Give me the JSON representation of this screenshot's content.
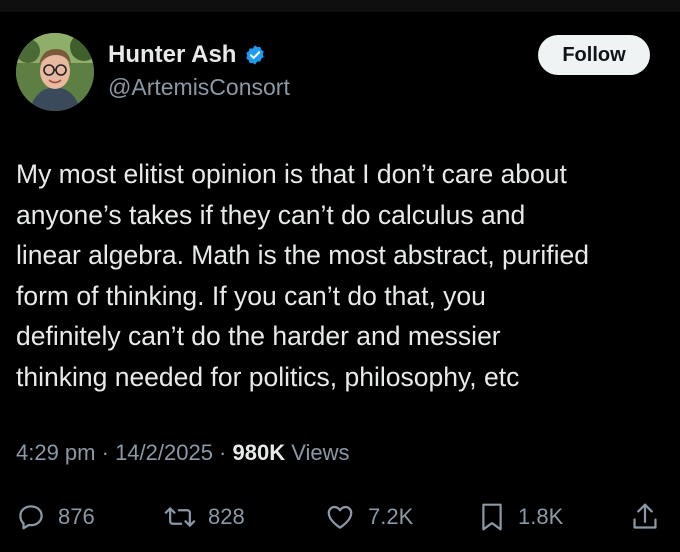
{
  "author": {
    "name": "Hunter Ash",
    "handle": "@ArtemisConsort",
    "verified_color": "#1d9bf0"
  },
  "follow_label": "Follow",
  "tweet": {
    "lines": [
      "My most elitist opinion is that I don’t care about",
      "anyone’s takes if they can’t do calculus and",
      "linear algebra. Math is the most abstract, purified",
      "form of thinking. If you can’t do that, you",
      "definitely can’t do the harder and messier",
      "thinking needed for politics, philosophy, etc"
    ]
  },
  "meta": {
    "time": "4:29 pm",
    "date": "14/2/2025",
    "separator": " · ",
    "views_count": "980K",
    "views_label": "Views"
  },
  "actions": {
    "replies": "876",
    "reposts": "828",
    "likes": "7.2K",
    "bookmarks": "1.8K"
  },
  "icons": [
    "verified-badge-icon",
    "reply-icon",
    "repost-icon",
    "like-icon",
    "bookmark-icon",
    "share-icon"
  ]
}
